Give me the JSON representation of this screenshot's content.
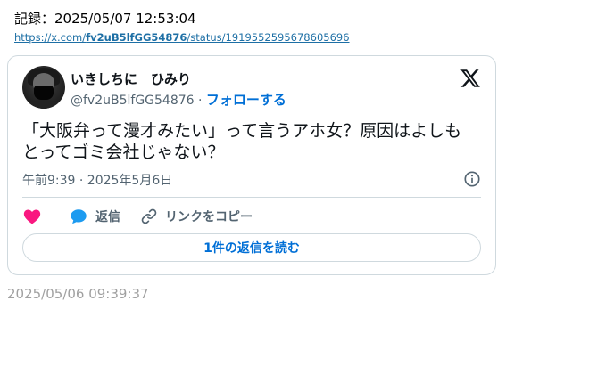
{
  "record": {
    "label": "記録：2025/05/07 12:53:04"
  },
  "source_url": {
    "prefix": "https://x.com/",
    "user": "fv2uB5lfGG54876",
    "suffix": "/status/1919552595678605696"
  },
  "tweet": {
    "display_name": "いきしちに　ひみり",
    "handle": "@fv2uB5lfGG54876",
    "separator": " · ",
    "follow_label": "フォローする",
    "text": "「大阪弁って漫才みたい」って言うアホ女？原因はよしもとってゴミ会社じゃない？",
    "timestamp": "午前9:39 · 2025年5月6日",
    "actions": {
      "reply_label": "返信",
      "copy_link_label": "リンクをコピー"
    },
    "read_replies_label": "1件の返信を読む"
  },
  "footer": {
    "date": "2025/05/06 09:39:37"
  },
  "colors": {
    "accent": "#006fd6",
    "like": "#f91880",
    "reply_bubble": "#1d9bf0",
    "muted_text": "#536471",
    "border": "#cfd9de"
  },
  "icons": [
    "x-logo-icon",
    "info-icon",
    "heart-icon",
    "reply-bubble-icon",
    "link-icon"
  ]
}
